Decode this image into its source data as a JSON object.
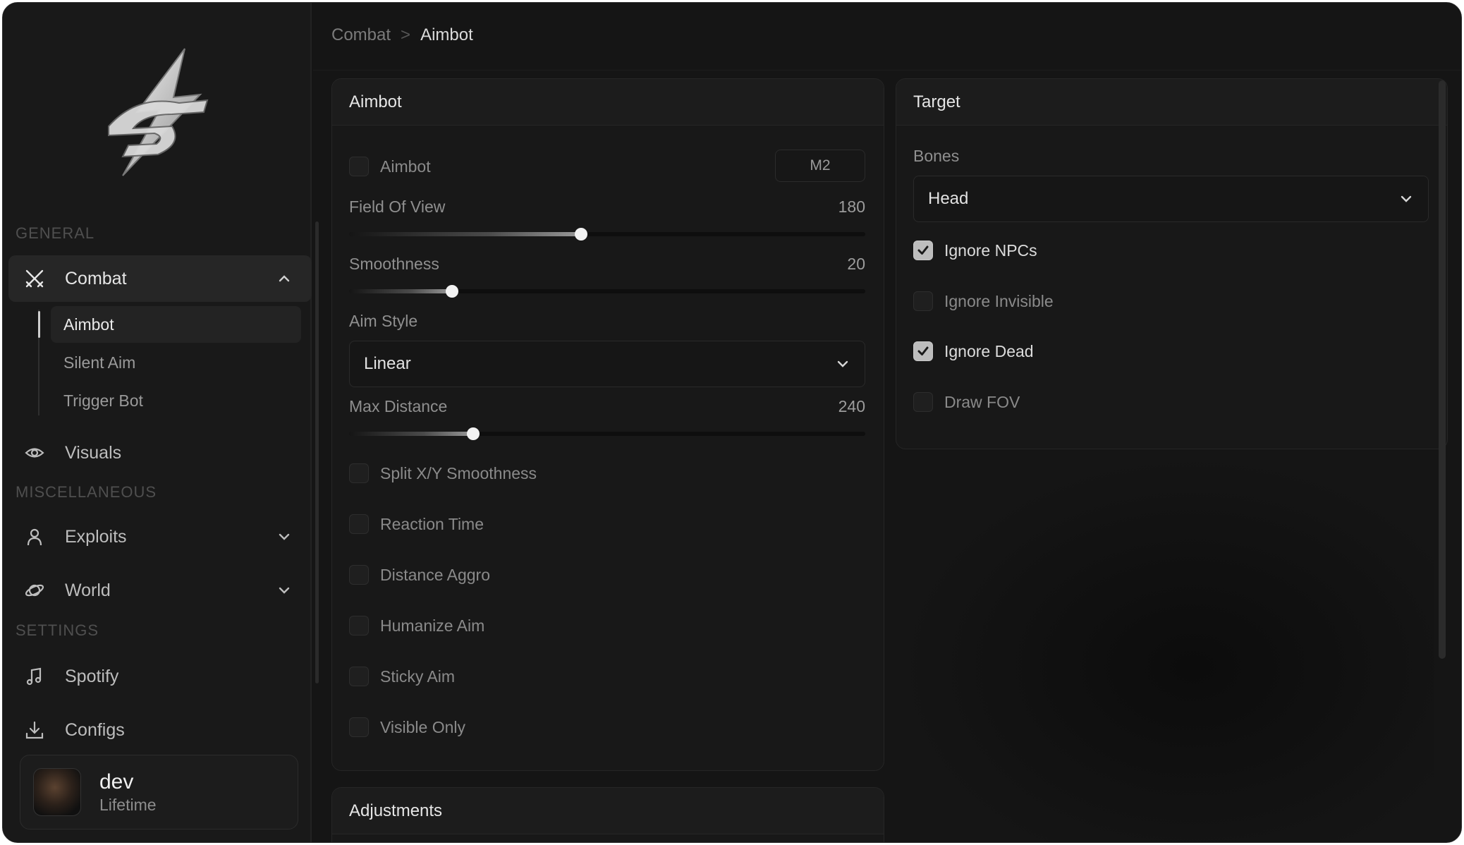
{
  "breadcrumb": {
    "parent": "Combat",
    "separator": ">",
    "current": "Aimbot"
  },
  "sidebar": {
    "sections": {
      "general": "GENERAL",
      "misc": "MISCELLANEOUS",
      "settings": "SETTINGS"
    },
    "items": {
      "combat": {
        "label": "Combat",
        "icon": "swords-icon",
        "expanded": true
      },
      "visuals": {
        "label": "Visuals",
        "icon": "eye-icon"
      },
      "exploits": {
        "label": "Exploits",
        "icon": "user-icon",
        "expanded": false
      },
      "world": {
        "label": "World",
        "icon": "planet-icon",
        "expanded": false
      },
      "spotify": {
        "label": "Spotify",
        "icon": "music-note-icon"
      },
      "configs": {
        "label": "Configs",
        "icon": "download-icon"
      }
    },
    "combat_sub": {
      "aimbot": "Aimbot",
      "silent_aim": "Silent Aim",
      "trigger_bot": "Trigger Bot"
    }
  },
  "user": {
    "name": "dev",
    "plan": "Lifetime"
  },
  "aimbot_panel": {
    "title": "Aimbot",
    "enable": {
      "label": "Aimbot",
      "checked": false,
      "keybind": "M2"
    },
    "fov": {
      "label": "Field Of View",
      "value": "180",
      "fraction": 0.45
    },
    "smoothness": {
      "label": "Smoothness",
      "value": "20",
      "fraction": 0.2
    },
    "aim_style": {
      "label": "Aim Style",
      "value": "Linear"
    },
    "max_distance": {
      "label": "Max Distance",
      "value": "240",
      "fraction": 0.24
    },
    "options": {
      "split_xy": {
        "label": "Split X/Y Smoothness",
        "checked": false
      },
      "reaction_time": {
        "label": "Reaction Time",
        "checked": false
      },
      "distance_aggro": {
        "label": "Distance Aggro",
        "checked": false
      },
      "humanize": {
        "label": "Humanize Aim",
        "checked": false
      },
      "sticky": {
        "label": "Sticky Aim",
        "checked": false
      },
      "visible_only": {
        "label": "Visible Only",
        "checked": false
      }
    }
  },
  "adjustments_panel": {
    "title": "Adjustments"
  },
  "target_panel": {
    "title": "Target",
    "bones": {
      "label": "Bones",
      "value": "Head"
    },
    "options": {
      "ignore_npcs": {
        "label": "Ignore NPCs",
        "checked": true
      },
      "ignore_invisible": {
        "label": "Ignore Invisible",
        "checked": false
      },
      "ignore_dead": {
        "label": "Ignore Dead",
        "checked": true
      },
      "draw_fov": {
        "label": "Draw FOV",
        "checked": false
      }
    }
  },
  "colors": {
    "background": "#151515",
    "panel": "#181818",
    "accent": "#f2f2f2",
    "muted_text": "#8a8a8a"
  }
}
